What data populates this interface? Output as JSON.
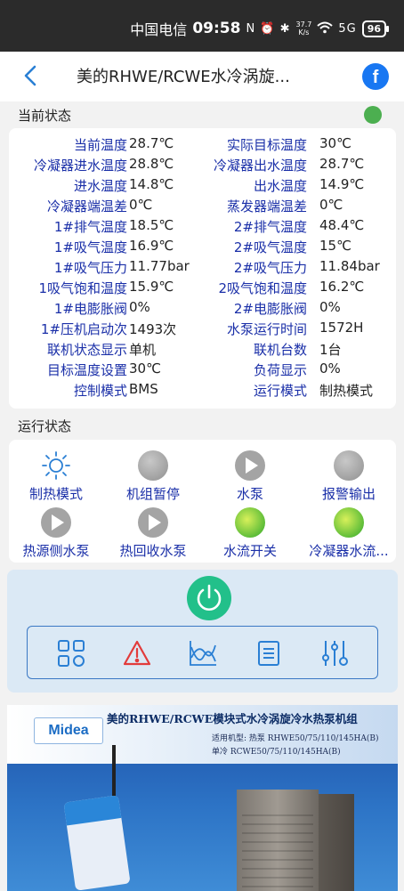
{
  "status_bar": {
    "carrier": "中国电信",
    "time": "09:58",
    "icons": "N ⏰ ✱",
    "speed_value": "37.7",
    "speed_unit": "K/s",
    "signal": "5G",
    "battery": "96"
  },
  "header": {
    "title": "美的RHWE/RCWE水冷涡旋...",
    "share": "f"
  },
  "current_status": {
    "title": "当前状态",
    "indicator_color": "#4caf50",
    "rows": [
      {
        "l_label": "当前温度",
        "l_value": "28.7℃",
        "r_label": "实际目标温度",
        "r_value": "30℃"
      },
      {
        "l_label": "冷凝器进水温度",
        "l_value": "28.8℃",
        "r_label": "冷凝器出水温度",
        "r_value": "28.7℃"
      },
      {
        "l_label": "进水温度",
        "l_value": "14.8℃",
        "r_label": "出水温度",
        "r_value": "14.9℃"
      },
      {
        "l_label": "冷凝器端温差",
        "l_value": "0℃",
        "r_label": "蒸发器端温差",
        "r_value": "0℃"
      },
      {
        "l_label": "1#排气温度",
        "l_value": "18.5℃",
        "r_label": "2#排气温度",
        "r_value": "48.4℃"
      },
      {
        "l_label": "1#吸气温度",
        "l_value": "16.9℃",
        "r_label": "2#吸气温度",
        "r_value": "15℃"
      },
      {
        "l_label": "1#吸气压力",
        "l_value": "11.77bar",
        "r_label": "2#吸气压力",
        "r_value": "11.84bar"
      },
      {
        "l_label": "1吸气饱和温度",
        "l_value": "15.9℃",
        "r_label": "2吸气饱和温度",
        "r_value": "16.2℃"
      },
      {
        "l_label": "1#电膨胀阀",
        "l_value": "0%",
        "r_label": "2#电膨胀阀",
        "r_value": "0%"
      },
      {
        "l_label": "1#压机启动次",
        "l_value": "1493次",
        "r_label": "水泵运行时间",
        "r_value": "1572H"
      },
      {
        "l_label": "联机状态显示",
        "l_value": "单机",
        "r_label": "联机台数",
        "r_value": "1台"
      },
      {
        "l_label": "目标温度设置",
        "l_value": "30℃",
        "r_label": "负荷显示",
        "r_value": "0%"
      },
      {
        "l_label": "控制模式",
        "l_value": "BMS",
        "r_label": "运行模式",
        "r_value": "制热模式"
      }
    ]
  },
  "run_status": {
    "title": "运行状态",
    "items": [
      {
        "label": "制热模式",
        "icon": "sun-icon"
      },
      {
        "label": "机组暂停",
        "icon": "gray-light-icon"
      },
      {
        "label": "水泵",
        "icon": "play-icon"
      },
      {
        "label": "报警输出",
        "icon": "gray-light-icon"
      },
      {
        "label": "热源侧水泵",
        "icon": "play-icon"
      },
      {
        "label": "热回收水泵",
        "icon": "play-icon"
      },
      {
        "label": "水流开关",
        "icon": "green-light-icon"
      },
      {
        "label": "冷凝器水流...",
        "icon": "green-light-icon"
      }
    ]
  },
  "controls": {
    "power_color": "#22c08a",
    "toolbar_icons": [
      "grid-icon",
      "warning-icon",
      "chart-icon",
      "list-icon",
      "settings-sliders-icon"
    ]
  },
  "banner": {
    "logo": "Midea",
    "title": "美的RHWE/RCWE模块式水冷涡旋冷水热泵机组",
    "line1": "适用机型: 热泵 RHWE50/75/110/145HA(B)",
    "line2": "单冷 RCWE50/75/110/145HA(B)"
  }
}
